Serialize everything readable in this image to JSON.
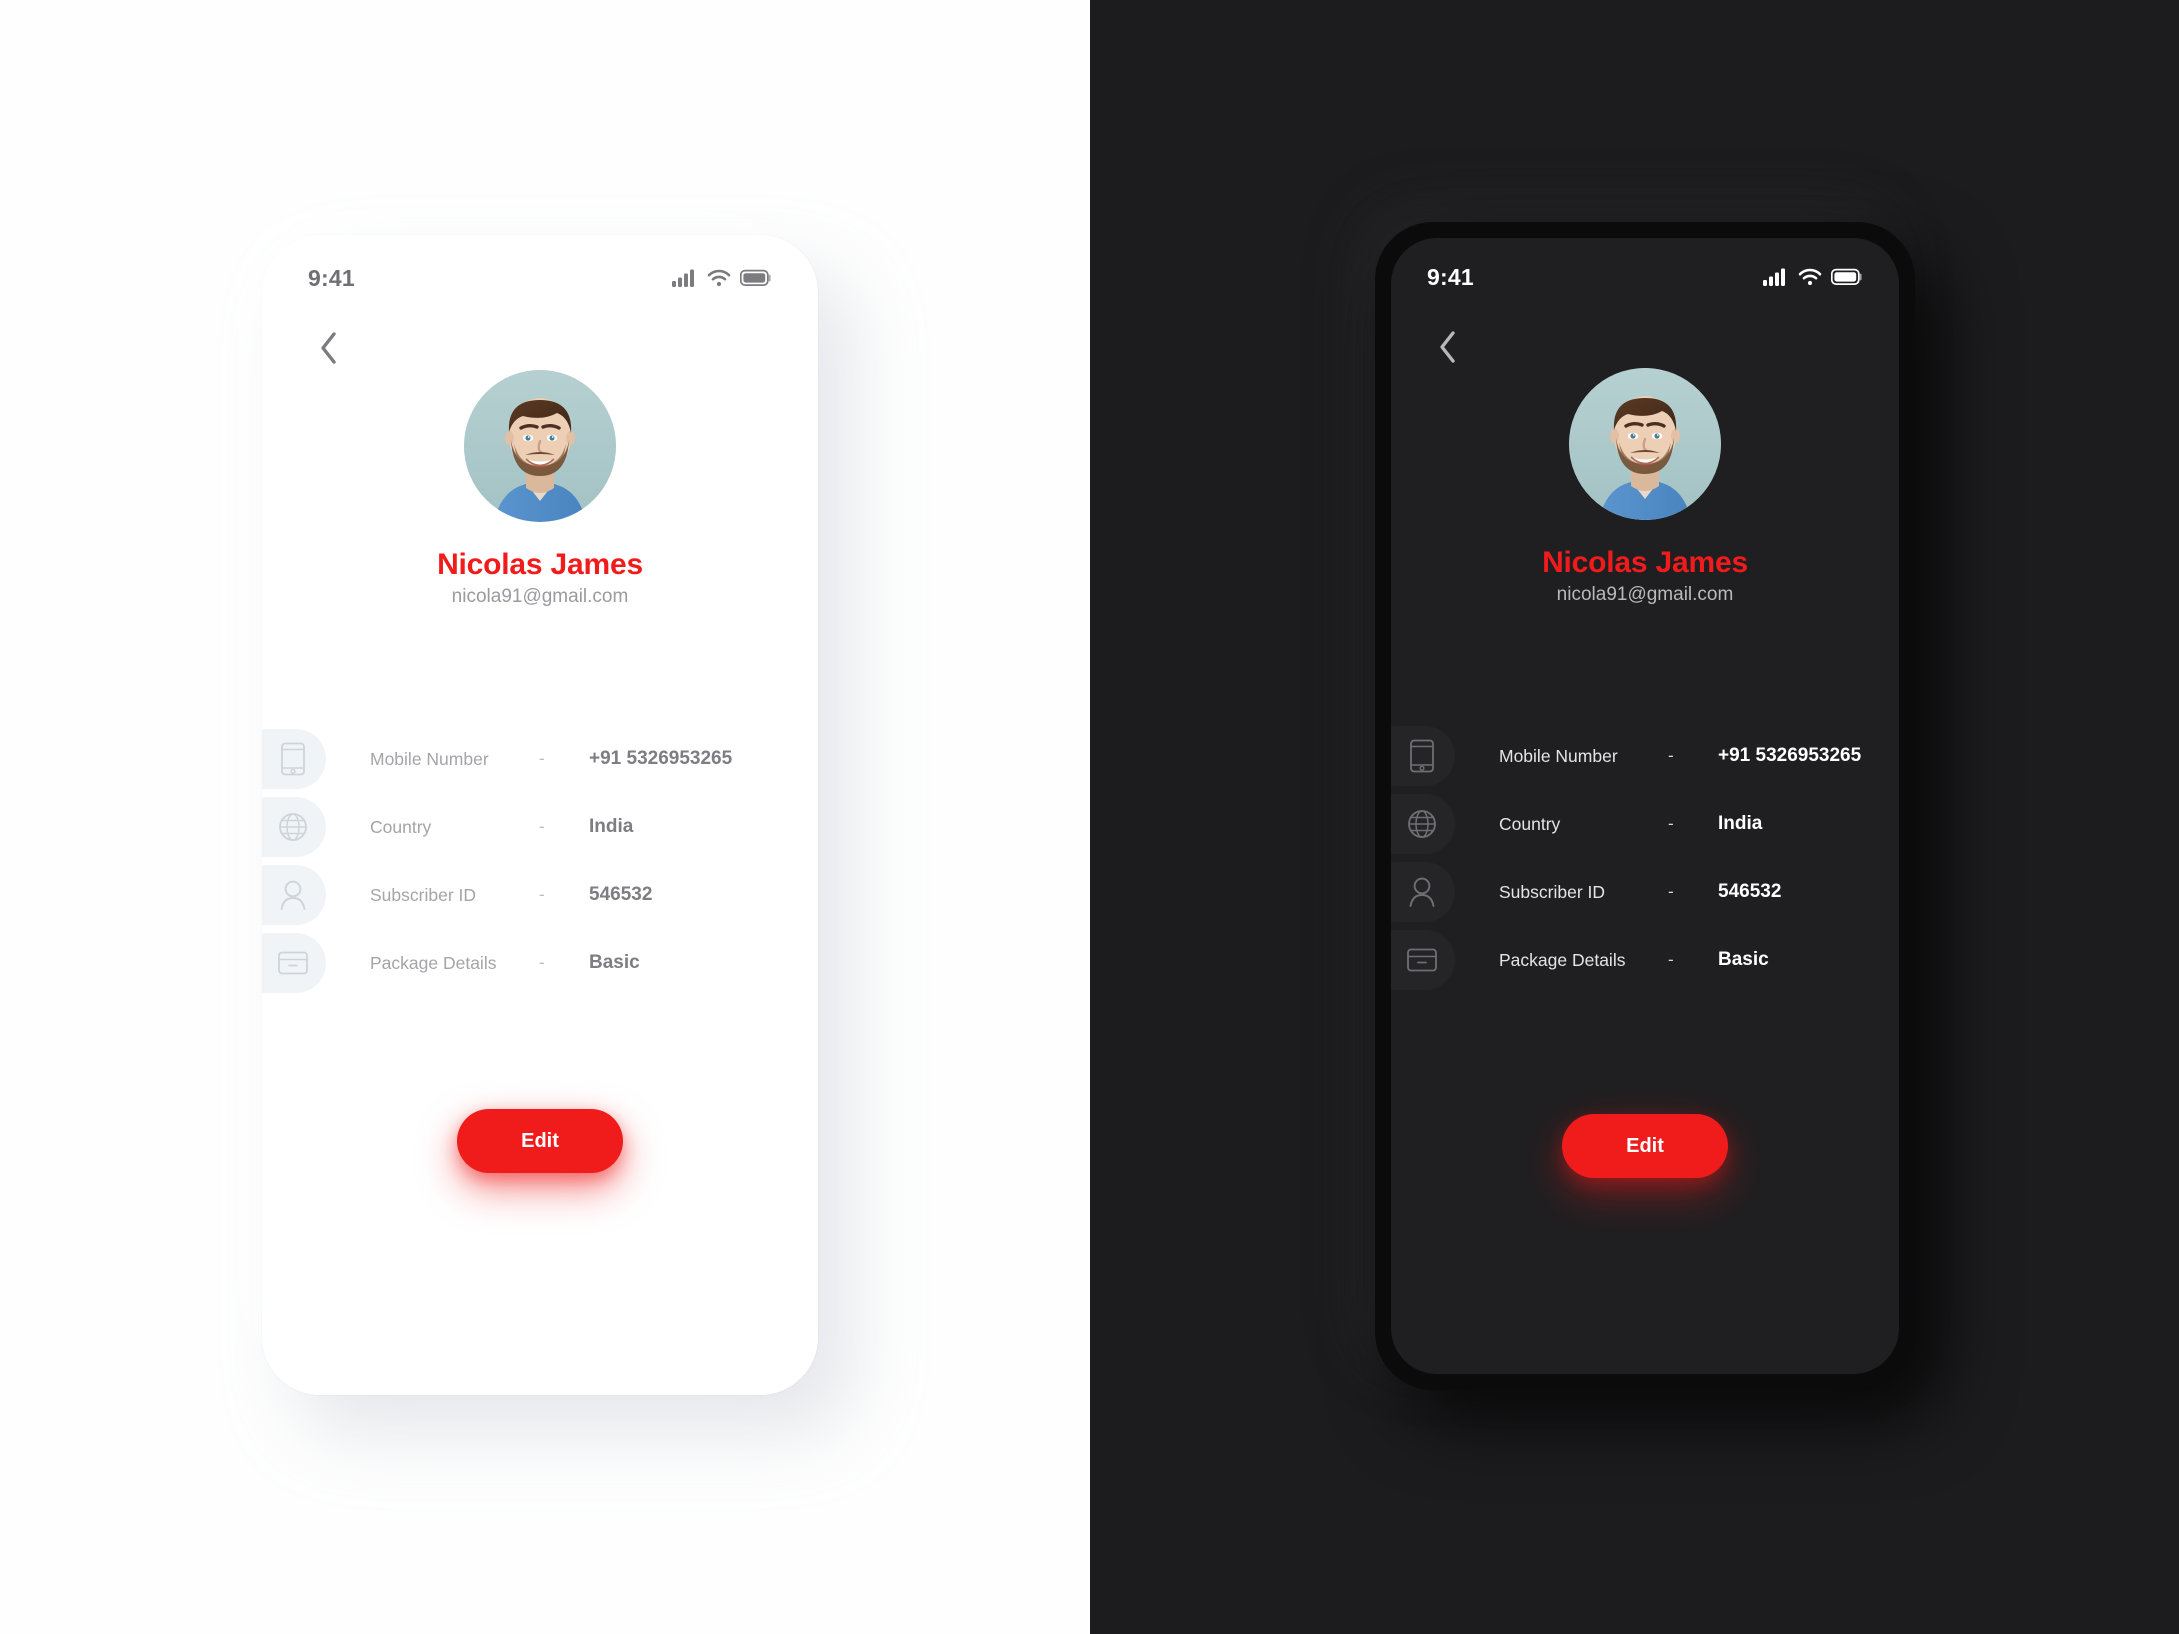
{
  "theme_colors": {
    "accent_red": "#F01B1B",
    "light_bg": "#FEFEFE",
    "dark_bg": "#1C1C1E",
    "dark_screen": "#1F1F21",
    "light_badge": "#F1F4F7",
    "dark_badge": "#252528",
    "light_muted_text": "#A4A4A9",
    "dark_text": "#FFFFFF",
    "avatar_backdrop": "#AAC6C8"
  },
  "status_bar": {
    "time": "9:41",
    "icons": [
      "cellular-signal-icon",
      "wifi-icon",
      "battery-icon"
    ]
  },
  "nav": {
    "back_icon": "chevron-left-icon"
  },
  "profile": {
    "avatar_alt": "user-avatar-photo",
    "name": "Nicolas James",
    "email": "nicola91@gmail.com"
  },
  "details": {
    "separator": "-",
    "rows": [
      {
        "icon": "mobile-phone-icon",
        "label": "Mobile Number",
        "value": "+91 5326953265"
      },
      {
        "icon": "globe-icon",
        "label": "Country",
        "value": "India"
      },
      {
        "icon": "user-icon",
        "label": "Subscriber ID",
        "value": "546532"
      },
      {
        "icon": "package-box-icon",
        "label": "Package Details",
        "value": "Basic"
      }
    ]
  },
  "actions": {
    "edit_label": "Edit"
  },
  "screens": [
    {
      "id": "light",
      "mode": "Light"
    },
    {
      "id": "dark",
      "mode": "Dark"
    }
  ]
}
